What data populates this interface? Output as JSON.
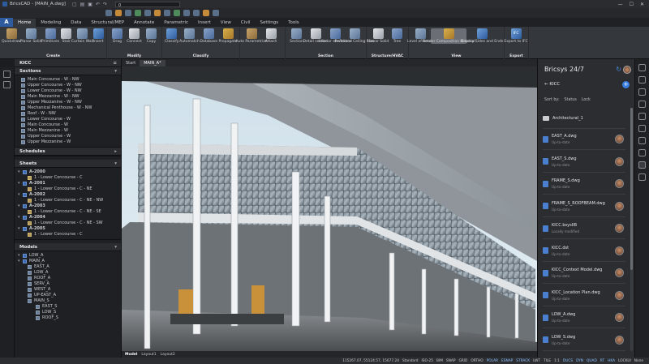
{
  "app": {
    "title": "BricsCAD - [MAIN_A.dwg]",
    "layer": "0"
  },
  "ribbon_tabs": [
    "Home",
    "Modeling",
    "Data",
    "Structural/MEP",
    "Annotate",
    "Parametric",
    "Insert",
    "View",
    "Civil",
    "Settings",
    "Tools"
  ],
  "active_tab": "Home",
  "ribbon": {
    "create": {
      "label": "Create",
      "buttons": [
        "Quickdraw",
        "Planar Solid",
        "Primitives",
        "Stair",
        "Curtain Wall",
        "Insert"
      ]
    },
    "modify": {
      "label": "Modify",
      "buttons": [
        "Drag",
        "Connect",
        "Copy"
      ]
    },
    "classify": {
      "label": "Classify",
      "buttons": [
        "Classify",
        "Automatch",
        "Database",
        "Propagate"
      ]
    },
    "mid": {
      "buttons": [
        "Auto Parametrize",
        "Attach"
      ]
    },
    "section": {
      "label": "Section",
      "buttons": [
        "Section",
        "Detail section",
        "Interior elevations",
        "Reflected Ceiling Plan"
      ]
    },
    "struct": {
      "label": "Structure/HVAC",
      "buttons": [
        "Linear Solid",
        "Tree"
      ]
    },
    "view": {
      "label": "View",
      "buttons": [
        "Level of detail",
        "Render Composition Material",
        "Display Sides and Ends"
      ]
    },
    "export": {
      "label": "Export",
      "ifc_label": "IFC",
      "buttons": [
        "Export to IFC"
      ]
    }
  },
  "left_panel": {
    "title": "KICC",
    "sections_title": "Sections",
    "sections": [
      "Main Concourse - W - NW",
      "Upper Concourse - W - NW",
      "Lower Concourse - W - NW",
      "Main Mezzanine - W - NW",
      "Upper Mezzanine - W - NW",
      "Mechanical Penthouse - W - NW",
      "Roof - W - NW",
      "Lower Concourse - W",
      "Main Concourse - W",
      "Main Mezzanine - W",
      "Upper Concourse - W",
      "Upper Mezzanine - W"
    ],
    "schedules_title": "Schedules",
    "sheets_title": "Sheets",
    "sheets": [
      {
        "id": "A-2000",
        "sub": "1 - Lower Concourse - C"
      },
      {
        "id": "A-2001",
        "sub": "1 - Lower Concourse - C - NE"
      },
      {
        "id": "A-2002",
        "sub": "1 - Lower Concourse - C - NE - NW"
      },
      {
        "id": "A-2003",
        "sub": "1 - Lower Concourse - C - NE - SE"
      },
      {
        "id": "A-2004",
        "sub": "1 - Lower Concourse - C - NE - SW"
      },
      {
        "id": "A-2005",
        "sub": "1 - Lower Concourse - C"
      }
    ],
    "models_title": "Models",
    "models_top": [
      "LOW_A",
      "MAIN_A"
    ],
    "models_sub": [
      "EAST_A",
      "LOW_A",
      "ROOF_A",
      "SERV_A",
      "WEST_A",
      "UP-EAST_A",
      "MAIN_S"
    ],
    "models_subsub": [
      "EAST_S",
      "LOW_S",
      "ROOF_S"
    ]
  },
  "doc_tabs": [
    "Start",
    "MAIN_A*"
  ],
  "active_doc": "MAIN_A*",
  "layout_tabs": [
    "Model",
    "Layout1",
    "Layout2"
  ],
  "active_layout": "Model",
  "statusbar": {
    "coords": "115267.07, 55124.57, 15677.24",
    "items": [
      "Standard",
      "ISO-25",
      "BIM",
      "SNAP",
      "GRID",
      "ORTHO",
      "POLAR",
      "ESNAP",
      "STRACK",
      "LWT",
      "TILE",
      "1:1",
      "DUCS",
      "DYN",
      "QUAD",
      "RT",
      "HKA",
      "LOCKUI",
      "None"
    ],
    "on_items": [
      "POLAR",
      "ESNAP",
      "STRACK",
      "DUCS",
      "DYN",
      "QUAD",
      "RT",
      "HKA"
    ]
  },
  "right_panel": {
    "title": "Bricsys 24/7",
    "back_label": "KICC",
    "sort_by": "Sort by:",
    "sort_status": "Status",
    "sort_lock": "Lock",
    "folder": "Architectural_1",
    "files": [
      {
        "name": "EAST_A.dwg",
        "status": "Up-to-date"
      },
      {
        "name": "EAST_S.dwg",
        "status": "Up-to-date"
      },
      {
        "name": "FRAME_S.dwg",
        "status": "Up-to-date"
      },
      {
        "name": "FRAME_S_ROOFBEAM.dwg",
        "status": "Up-to-date"
      },
      {
        "name": "KICC.bsysIIB",
        "status": "Locally modified"
      },
      {
        "name": "KICC.dst",
        "status": "Up-to-date"
      },
      {
        "name": "KICC_Context Model.dwg",
        "status": "Up-to-date"
      },
      {
        "name": "KICC_Location Plan.dwg",
        "status": "Up-to-date"
      },
      {
        "name": "LOW_A.dwg",
        "status": "Up-to-date"
      },
      {
        "name": "LOW_S.dwg",
        "status": "Up-to-date"
      }
    ]
  }
}
